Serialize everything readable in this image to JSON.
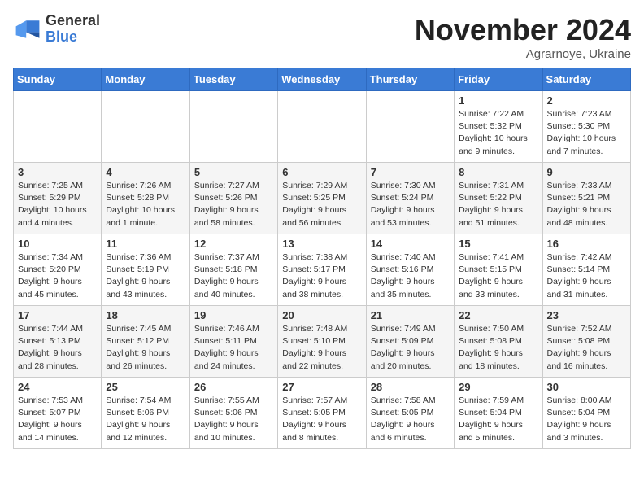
{
  "header": {
    "logo_general": "General",
    "logo_blue": "Blue",
    "month_title": "November 2024",
    "location": "Agrarnoye, Ukraine"
  },
  "days_of_week": [
    "Sunday",
    "Monday",
    "Tuesday",
    "Wednesday",
    "Thursday",
    "Friday",
    "Saturday"
  ],
  "weeks": [
    [
      {
        "day": "",
        "info": ""
      },
      {
        "day": "",
        "info": ""
      },
      {
        "day": "",
        "info": ""
      },
      {
        "day": "",
        "info": ""
      },
      {
        "day": "",
        "info": ""
      },
      {
        "day": "1",
        "info": "Sunrise: 7:22 AM\nSunset: 5:32 PM\nDaylight: 10 hours and 9 minutes."
      },
      {
        "day": "2",
        "info": "Sunrise: 7:23 AM\nSunset: 5:30 PM\nDaylight: 10 hours and 7 minutes."
      }
    ],
    [
      {
        "day": "3",
        "info": "Sunrise: 7:25 AM\nSunset: 5:29 PM\nDaylight: 10 hours and 4 minutes."
      },
      {
        "day": "4",
        "info": "Sunrise: 7:26 AM\nSunset: 5:28 PM\nDaylight: 10 hours and 1 minute."
      },
      {
        "day": "5",
        "info": "Sunrise: 7:27 AM\nSunset: 5:26 PM\nDaylight: 9 hours and 58 minutes."
      },
      {
        "day": "6",
        "info": "Sunrise: 7:29 AM\nSunset: 5:25 PM\nDaylight: 9 hours and 56 minutes."
      },
      {
        "day": "7",
        "info": "Sunrise: 7:30 AM\nSunset: 5:24 PM\nDaylight: 9 hours and 53 minutes."
      },
      {
        "day": "8",
        "info": "Sunrise: 7:31 AM\nSunset: 5:22 PM\nDaylight: 9 hours and 51 minutes."
      },
      {
        "day": "9",
        "info": "Sunrise: 7:33 AM\nSunset: 5:21 PM\nDaylight: 9 hours and 48 minutes."
      }
    ],
    [
      {
        "day": "10",
        "info": "Sunrise: 7:34 AM\nSunset: 5:20 PM\nDaylight: 9 hours and 45 minutes."
      },
      {
        "day": "11",
        "info": "Sunrise: 7:36 AM\nSunset: 5:19 PM\nDaylight: 9 hours and 43 minutes."
      },
      {
        "day": "12",
        "info": "Sunrise: 7:37 AM\nSunset: 5:18 PM\nDaylight: 9 hours and 40 minutes."
      },
      {
        "day": "13",
        "info": "Sunrise: 7:38 AM\nSunset: 5:17 PM\nDaylight: 9 hours and 38 minutes."
      },
      {
        "day": "14",
        "info": "Sunrise: 7:40 AM\nSunset: 5:16 PM\nDaylight: 9 hours and 35 minutes."
      },
      {
        "day": "15",
        "info": "Sunrise: 7:41 AM\nSunset: 5:15 PM\nDaylight: 9 hours and 33 minutes."
      },
      {
        "day": "16",
        "info": "Sunrise: 7:42 AM\nSunset: 5:14 PM\nDaylight: 9 hours and 31 minutes."
      }
    ],
    [
      {
        "day": "17",
        "info": "Sunrise: 7:44 AM\nSunset: 5:13 PM\nDaylight: 9 hours and 28 minutes."
      },
      {
        "day": "18",
        "info": "Sunrise: 7:45 AM\nSunset: 5:12 PM\nDaylight: 9 hours and 26 minutes."
      },
      {
        "day": "19",
        "info": "Sunrise: 7:46 AM\nSunset: 5:11 PM\nDaylight: 9 hours and 24 minutes."
      },
      {
        "day": "20",
        "info": "Sunrise: 7:48 AM\nSunset: 5:10 PM\nDaylight: 9 hours and 22 minutes."
      },
      {
        "day": "21",
        "info": "Sunrise: 7:49 AM\nSunset: 5:09 PM\nDaylight: 9 hours and 20 minutes."
      },
      {
        "day": "22",
        "info": "Sunrise: 7:50 AM\nSunset: 5:08 PM\nDaylight: 9 hours and 18 minutes."
      },
      {
        "day": "23",
        "info": "Sunrise: 7:52 AM\nSunset: 5:08 PM\nDaylight: 9 hours and 16 minutes."
      }
    ],
    [
      {
        "day": "24",
        "info": "Sunrise: 7:53 AM\nSunset: 5:07 PM\nDaylight: 9 hours and 14 minutes."
      },
      {
        "day": "25",
        "info": "Sunrise: 7:54 AM\nSunset: 5:06 PM\nDaylight: 9 hours and 12 minutes."
      },
      {
        "day": "26",
        "info": "Sunrise: 7:55 AM\nSunset: 5:06 PM\nDaylight: 9 hours and 10 minutes."
      },
      {
        "day": "27",
        "info": "Sunrise: 7:57 AM\nSunset: 5:05 PM\nDaylight: 9 hours and 8 minutes."
      },
      {
        "day": "28",
        "info": "Sunrise: 7:58 AM\nSunset: 5:05 PM\nDaylight: 9 hours and 6 minutes."
      },
      {
        "day": "29",
        "info": "Sunrise: 7:59 AM\nSunset: 5:04 PM\nDaylight: 9 hours and 5 minutes."
      },
      {
        "day": "30",
        "info": "Sunrise: 8:00 AM\nSunset: 5:04 PM\nDaylight: 9 hours and 3 minutes."
      }
    ]
  ]
}
